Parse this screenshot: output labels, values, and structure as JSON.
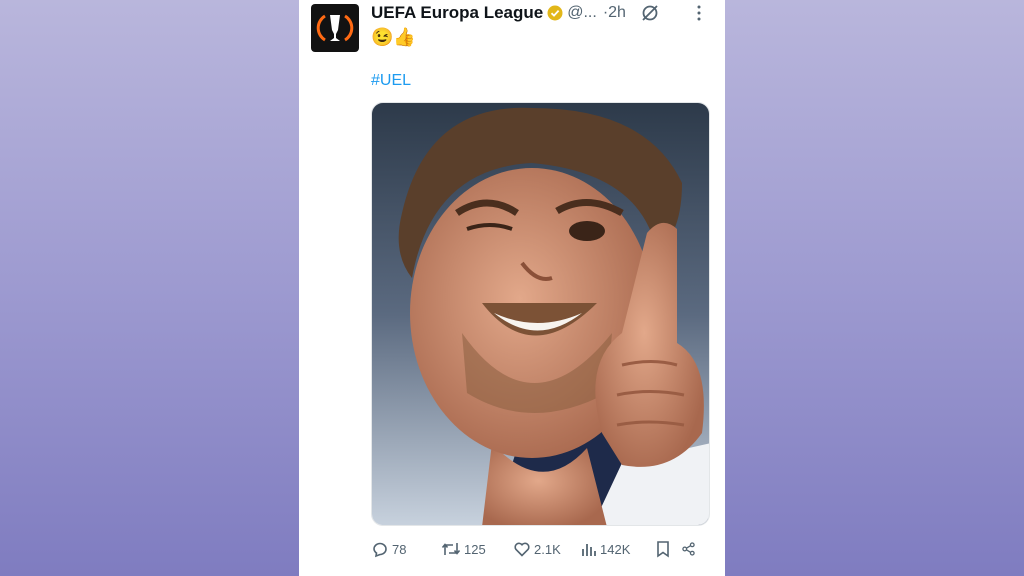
{
  "tweet": {
    "display_name": "UEFA Europa League",
    "handle": "@...",
    "time": "·2h",
    "text": "😉👍",
    "hashtag": "#UEL",
    "media_alt": "Smiling player giving a thumbs up"
  },
  "actions": {
    "replies": "78",
    "reposts": "125",
    "likes": "2.1K",
    "views": "142K"
  },
  "colors": {
    "accent": "#1d9bf0",
    "verified_gold": "#e2b719",
    "muted": "#536471",
    "background_top": "#b9b6dc",
    "background_bottom": "#7f7cc0"
  },
  "icons": [
    "verified-badge-icon",
    "grok-icon",
    "more-icon",
    "reply-icon",
    "repost-icon",
    "like-icon",
    "views-icon",
    "bookmark-icon",
    "share-icon"
  ]
}
